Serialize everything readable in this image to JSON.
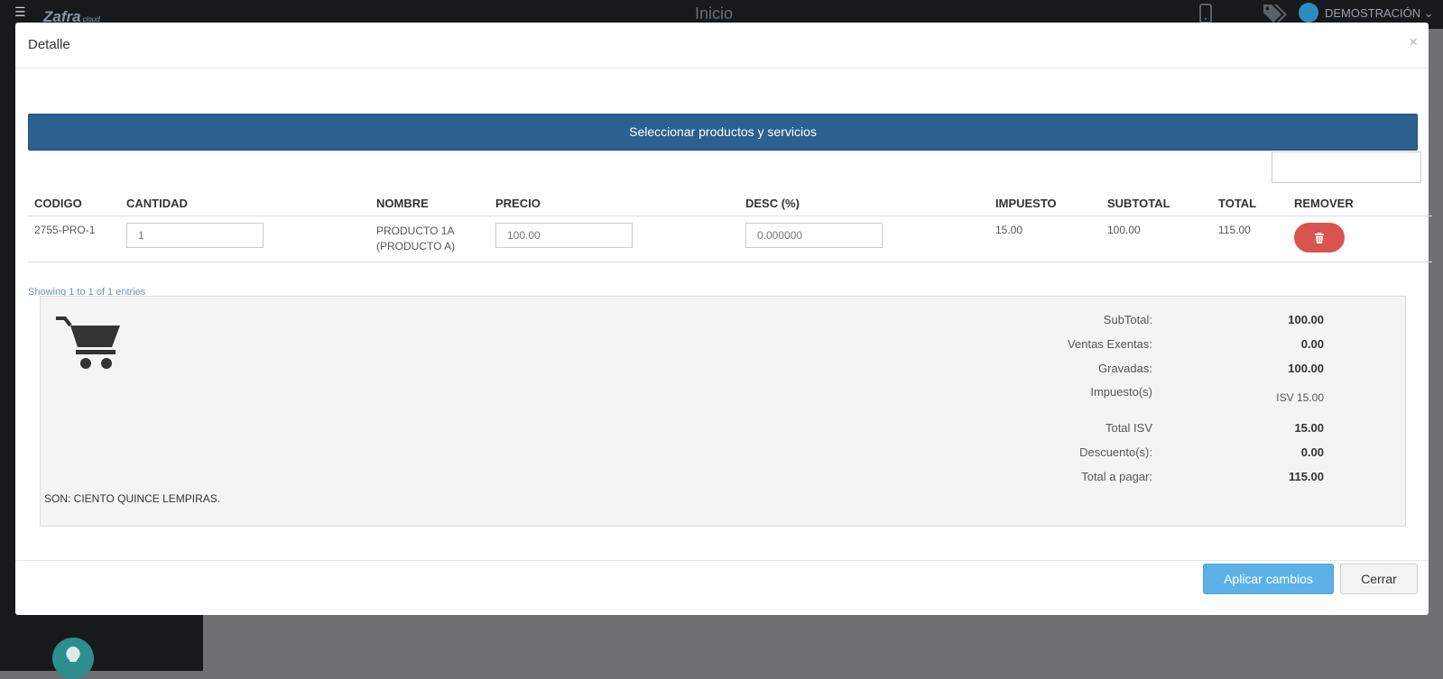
{
  "app": {
    "title": "Inicio",
    "logo": "Zafra",
    "logo_suffix": "cloud",
    "user": "DEMOSTRACIÓN ⌄"
  },
  "modal": {
    "title": "Detalle",
    "close_label": "×",
    "select_button": "Seleccionar productos y servicios",
    "search_value": ""
  },
  "table": {
    "headers": [
      "CODIGO",
      "CANTIDAD",
      "NOMBRE",
      "PRECIO",
      "DESC (%)",
      "IMPUESTO",
      "SUBTOTAL",
      "TOTAL",
      "REMOVER"
    ],
    "rows": [
      {
        "codigo": "2755-PRO-1",
        "cantidad": "1",
        "nombre": "PRODUCTO 1A (PRODUCTO A)",
        "precio": "100.00",
        "desc": "0.000000",
        "impuesto": "15.00",
        "subtotal": "100.00",
        "total": "115.00"
      }
    ],
    "info": "Showing 1 to 1 of 1 entries"
  },
  "summary": {
    "subtotal_label": "SubTotal:",
    "subtotal_value": "100.00",
    "exentas_label": "Ventas Exentas:",
    "exentas_value": "0.00",
    "gravadas_label": "Gravadas:",
    "gravadas_value": "100.00",
    "impuestos_label": "Impuesto(s)",
    "impuestos_value": "ISV 15.00",
    "total_isv_label": "Total ISV",
    "total_isv_value": "15.00",
    "descuentos_label": "Descuento(s):",
    "descuentos_value": "0.00",
    "total_pagar_label": "Total a pagar:",
    "total_pagar_value": "115.00",
    "son": "SON: CIENTO QUINCE LEMPIRAS."
  },
  "footer": {
    "apply": "Aplicar cambios",
    "close": "Cerrar"
  },
  "colors": {
    "primary_bar": "#2b608f",
    "apply_button": "#5bb1e5",
    "remove_button": "#d9534f"
  }
}
